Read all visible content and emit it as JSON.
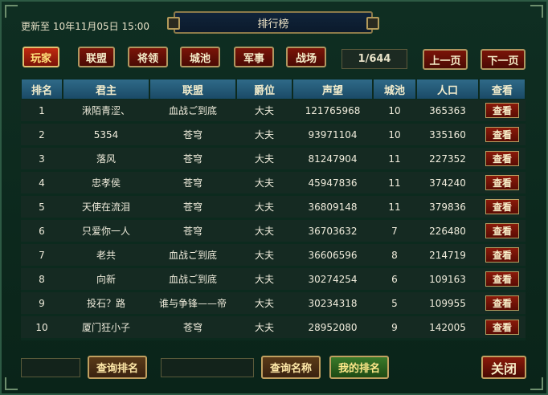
{
  "header": {
    "update_text": "更新至 10年11月05日 15:00",
    "title": "排行榜"
  },
  "tabs": [
    {
      "label": "玩家",
      "active": true
    },
    {
      "label": "联盟",
      "active": false
    },
    {
      "label": "将领",
      "active": false
    },
    {
      "label": "城池",
      "active": false
    },
    {
      "label": "军事",
      "active": false
    },
    {
      "label": "战场",
      "active": false
    }
  ],
  "pagination": {
    "page_indicator": "1/644",
    "prev_label": "上一页",
    "next_label": "下一页"
  },
  "table": {
    "columns": [
      "排名",
      "君主",
      "联盟",
      "爵位",
      "声望",
      "城池",
      "人口",
      "查看"
    ],
    "view_label": "查看",
    "rows": [
      {
        "rank": "1",
        "lord": "湫陌青涩、",
        "alliance": "血战ご到底",
        "title": "大夫",
        "prestige": "121765968",
        "cities": "10",
        "population": "365363"
      },
      {
        "rank": "2",
        "lord": "5354",
        "alliance": "苍穹",
        "title": "大夫",
        "prestige": "93971104",
        "cities": "10",
        "population": "335160"
      },
      {
        "rank": "3",
        "lord": "落风",
        "alliance": "苍穹",
        "title": "大夫",
        "prestige": "81247904",
        "cities": "11",
        "population": "227352"
      },
      {
        "rank": "4",
        "lord": "忠孝侯",
        "alliance": "苍穹",
        "title": "大夫",
        "prestige": "45947836",
        "cities": "11",
        "population": "374240"
      },
      {
        "rank": "5",
        "lord": "天使在流泪",
        "alliance": "苍穹",
        "title": "大夫",
        "prestige": "36809148",
        "cities": "11",
        "population": "379836"
      },
      {
        "rank": "6",
        "lord": "只爱你一人",
        "alliance": "苍穹",
        "title": "大夫",
        "prestige": "36703632",
        "cities": "7",
        "population": "226480"
      },
      {
        "rank": "7",
        "lord": "老共",
        "alliance": "血战ご到底",
        "title": "大夫",
        "prestige": "36606596",
        "cities": "8",
        "population": "214719"
      },
      {
        "rank": "8",
        "lord": "向新",
        "alliance": "血战ご到底",
        "title": "大夫",
        "prestige": "30274254",
        "cities": "6",
        "population": "109163"
      },
      {
        "rank": "9",
        "lord": "投石？路",
        "alliance": "谁与争锋——帝",
        "title": "大夫",
        "prestige": "30234318",
        "cities": "5",
        "population": "109955"
      },
      {
        "rank": "10",
        "lord": "厦门狂小子",
        "alliance": "苍穹",
        "title": "大夫",
        "prestige": "28952080",
        "cities": "9",
        "population": "142005"
      }
    ]
  },
  "footer": {
    "query_rank_label": "查询排名",
    "query_name_label": "查询名称",
    "my_rank_label": "我的排名",
    "close_label": "关闭"
  }
}
